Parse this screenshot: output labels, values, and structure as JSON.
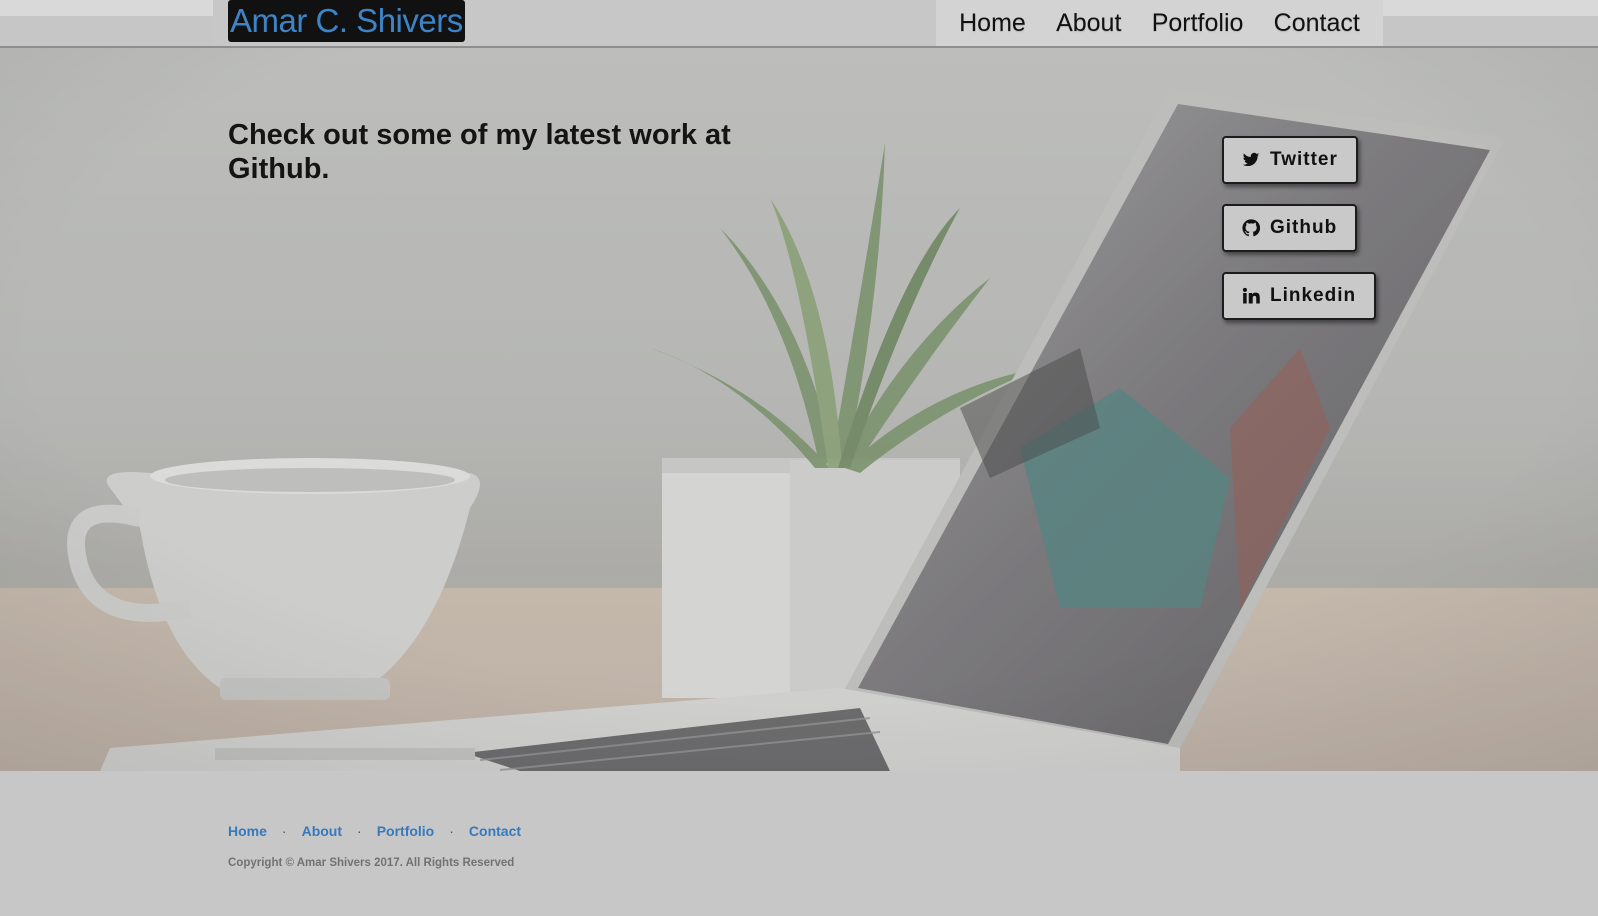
{
  "header": {
    "brand": "Amar C. Shivers",
    "nav": [
      "Home",
      "About",
      "Portfolio",
      "Contact"
    ]
  },
  "hero": {
    "headline": "Check out some of my latest work at Github."
  },
  "social": {
    "twitter": "Twitter",
    "github": "Github",
    "linkedin": "Linkedin"
  },
  "footer": {
    "links": [
      "Home",
      "About",
      "Portfolio",
      "Contact"
    ],
    "separator": "·",
    "copyright": "Copyright © Amar Shivers 2017. All Rights Reserved"
  },
  "colors": {
    "brand_text": "#3d84c6",
    "brand_background": "#111111",
    "footer_link": "#3579be"
  },
  "icons": [
    "twitter-icon",
    "github-icon",
    "linkedin-icon"
  ]
}
